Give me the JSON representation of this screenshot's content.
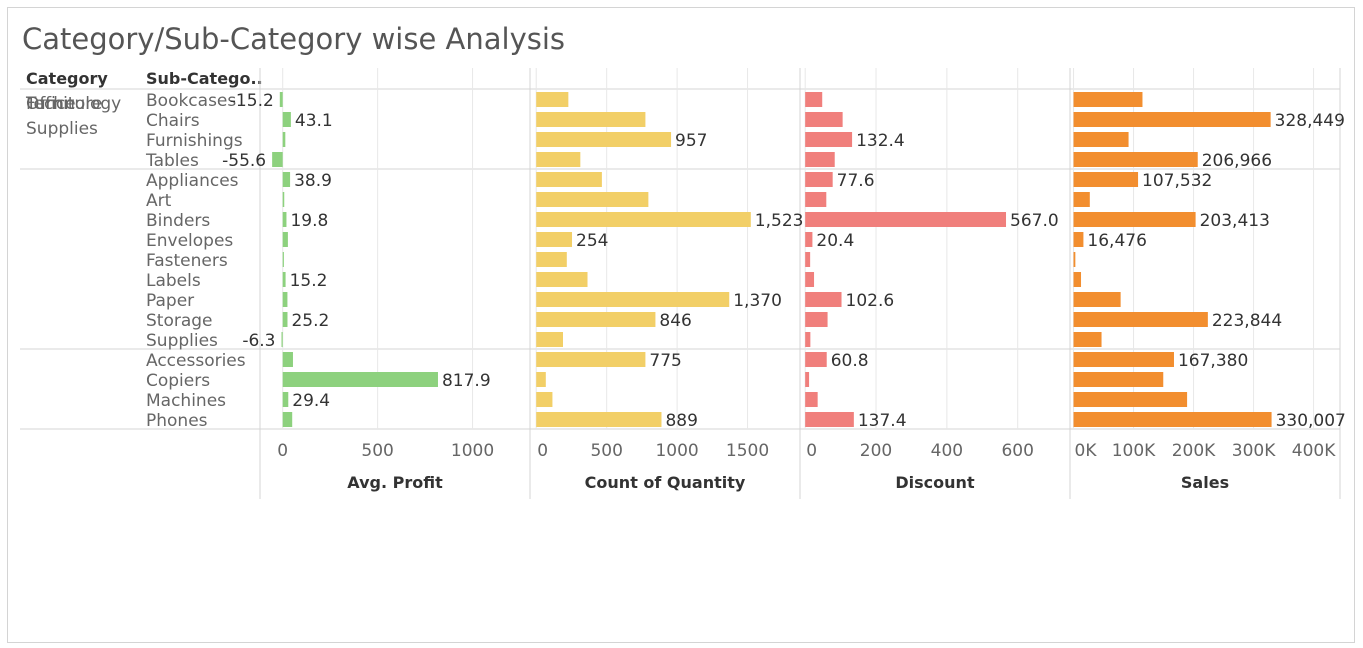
{
  "title": "Category/Sub-Category wise Analysis",
  "headers": {
    "category": "Category",
    "subcategory": "Sub-Catego.."
  },
  "colors": {
    "profit": "#8dd17e",
    "quantity": "#f2cf67",
    "discount": "#f07f7c",
    "sales": "#f28e2f",
    "grid": "#e8e8e8",
    "border": "#d4d4d4"
  },
  "chart_data": {
    "type": "bar",
    "groups": [
      {
        "category": [
          "Furniture"
        ],
        "subcategories": [
          "Bookcases",
          "Chairs",
          "Furnishings",
          "Tables"
        ]
      },
      {
        "category": [
          "Office",
          "Supplies"
        ],
        "subcategories": [
          "Appliances",
          "Art",
          "Binders",
          "Envelopes",
          "Fasteners",
          "Labels",
          "Paper",
          "Storage",
          "Supplies"
        ]
      },
      {
        "category": [
          "Technology"
        ],
        "subcategories": [
          "Accessories",
          "Copiers",
          "Machines",
          "Phones"
        ]
      }
    ],
    "panels": [
      {
        "id": "profit",
        "label": "Avg. Profit",
        "domain": [
          -109,
          1292
        ],
        "ticks": [
          0,
          500,
          1000
        ],
        "tick_labels": [
          "0",
          "500",
          "1000"
        ],
        "values": [
          -15.2,
          43.1,
          13.8,
          -55.6,
          38.9,
          8.2,
          19.8,
          27.4,
          4.4,
          15.2,
          24.9,
          25.2,
          -6.3,
          54.1,
          817.9,
          29.4,
          50.1
        ],
        "labels": [
          "-15.2",
          "43.1",
          "",
          "-55.6",
          "38.9",
          "",
          "19.8",
          "",
          "",
          "15.2",
          "",
          "25.2",
          "-6.3",
          "",
          "817.9",
          "29.4",
          ""
        ]
      },
      {
        "id": "quantity",
        "label": "Count of Quantity",
        "domain": [
          -30,
          1858
        ],
        "ticks": [
          0,
          500,
          1000,
          1500
        ],
        "tick_labels": [
          "0",
          "500",
          "1000",
          "1500"
        ],
        "values": [
          228,
          775,
          957,
          313,
          466,
          796,
          1523,
          254,
          217,
          364,
          1370,
          846,
          190,
          775,
          68,
          115,
          889
        ],
        "labels": [
          "",
          "",
          "957",
          "",
          "",
          "",
          "1,523",
          "254",
          "",
          "",
          "1,370",
          "846",
          "",
          "775",
          "",
          "",
          "889"
        ]
      },
      {
        "id": "discount",
        "label": "Discount",
        "domain": [
          -9,
          742
        ],
        "ticks": [
          0,
          200,
          400,
          600
        ],
        "tick_labels": [
          "0",
          "200",
          "400",
          "600"
        ],
        "values": [
          48.1,
          105.7,
          132.4,
          83.4,
          77.6,
          59.6,
          567.0,
          20.4,
          14.0,
          25.0,
          102.6,
          63.2,
          14.6,
          60.8,
          11.0,
          35.2,
          137.4
        ],
        "labels": [
          "",
          "",
          "132.4",
          "",
          "77.6",
          "",
          "567.0",
          "20.4",
          "",
          "",
          "102.6",
          "",
          "",
          "60.8",
          "",
          "",
          "137.4"
        ]
      },
      {
        "id": "sales",
        "label": "Sales",
        "domain": [
          -2550,
          440700
        ],
        "ticks": [
          0,
          100000,
          200000,
          300000,
          400000
        ],
        "tick_labels": [
          "0K",
          "100K",
          "200K",
          "300K",
          "400K"
        ],
        "values": [
          114880,
          328449,
          91705,
          206966,
          107532,
          27119,
          203413,
          16476,
          3024,
          12486,
          78479,
          223844,
          46674,
          167380,
          149528,
          189239,
          330007
        ],
        "labels": [
          "",
          "328,449",
          "",
          "206,966",
          "107,532",
          "",
          "203,413",
          "16,476",
          "",
          "",
          "",
          "223,844",
          "",
          "167,380",
          "",
          "",
          "330,007"
        ]
      }
    ]
  }
}
